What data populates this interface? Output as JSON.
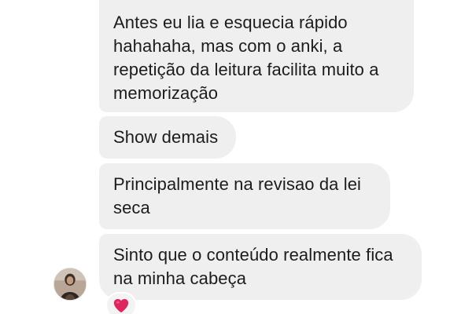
{
  "messages": [
    {
      "text": "Antes eu lia e esquecia rápido\nhahahaha, mas com o anki, a\nrepetição da leitura facilita muito a\nmemorização"
    },
    {
      "text": "Show demais"
    },
    {
      "text": "Principalmente na revisao da lei\nseca"
    },
    {
      "text": "Sinto que o conteúdo realmente fica\nna minha cabeça"
    }
  ],
  "reaction": {
    "icon": "heart-icon",
    "color": "#e0245e"
  },
  "avatar": {
    "icon": "user-avatar"
  },
  "colors": {
    "bubble": "#efefef",
    "text": "#1c1c1c",
    "background": "#ffffff"
  }
}
